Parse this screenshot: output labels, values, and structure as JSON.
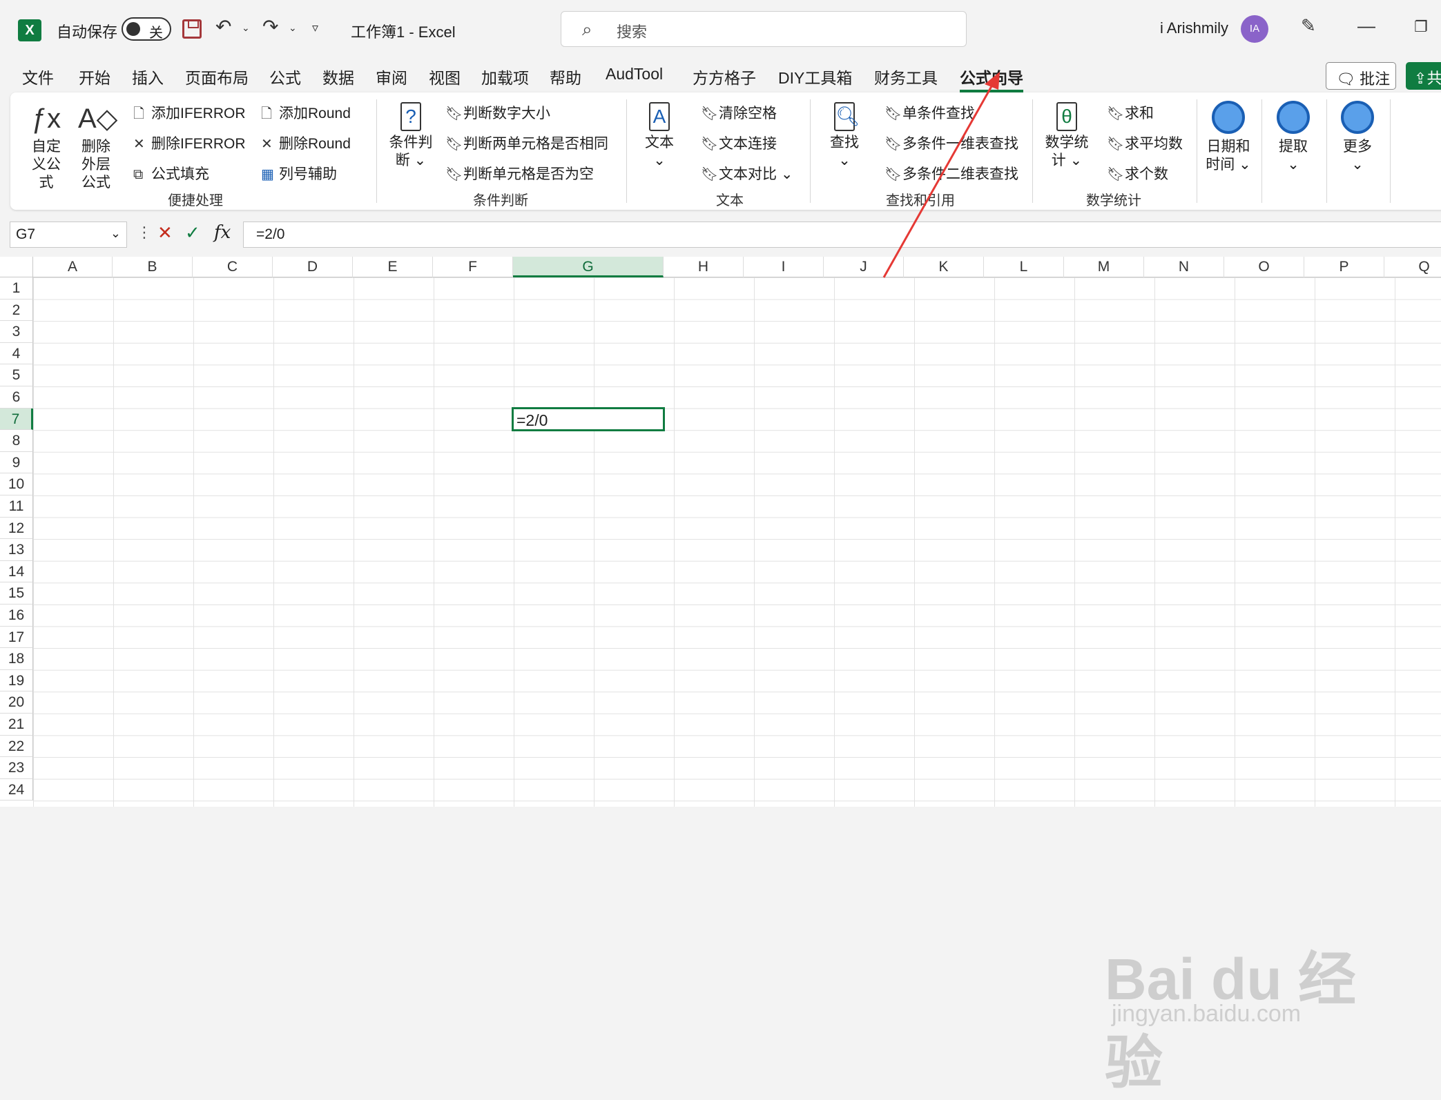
{
  "titlebar": {
    "autosave_label": "自动保存",
    "autosave_state": "关",
    "doc_title": "工作簿1  -  Excel",
    "search_placeholder": "搜索",
    "user_name": "i Arishmily",
    "avatar_initials": "IA"
  },
  "menu": {
    "tabs": [
      "文件",
      "开始",
      "插入",
      "页面布局",
      "公式",
      "数据",
      "审阅",
      "视图",
      "加载项",
      "帮助",
      "AudTool",
      "方方格子",
      "DIY工具箱",
      "财务工具",
      "公式向导"
    ],
    "active_tab": "公式向导",
    "comment_label": "批注",
    "share_label": "共"
  },
  "ribbon": {
    "quick": {
      "custom_formula": "自定义公式",
      "remove_outer": "删除外层公式",
      "add_iferror": "添加IFERROR",
      "del_iferror": "删除IFERROR",
      "formula_fill": "公式填充",
      "add_round": "添加Round",
      "del_round": "删除Round",
      "col_helper": "列号辅助",
      "label": "便捷处理"
    },
    "cond": {
      "big": "条件判断",
      "i1": "判断数字大小",
      "i2": "判断两单元格是否相同",
      "i3": "判断单元格是否为空",
      "label": "条件判断"
    },
    "text": {
      "big": "文本",
      "i1": "清除空格",
      "i2": "文本连接",
      "i3": "文本对比",
      "label": "文本"
    },
    "lookup": {
      "big": "查找",
      "i1": "单条件查找",
      "i2": "多条件一维表查找",
      "i3": "多条件二维表查找",
      "label": "查找和引用"
    },
    "math": {
      "big": "数学统计",
      "i1": "求和",
      "i2": "求平均数",
      "i3": "求个数",
      "label": "数学统计"
    },
    "datetime": "日期和时间",
    "extract": "提取",
    "more": "更多"
  },
  "formula_bar": {
    "name_box": "G7",
    "formula": "=2/0"
  },
  "grid": {
    "columns": [
      "A",
      "B",
      "C",
      "D",
      "E",
      "F",
      "G",
      "H",
      "I",
      "J",
      "K",
      "L",
      "M",
      "N",
      "O",
      "P",
      "Q"
    ],
    "rows": [
      "1",
      "2",
      "3",
      "4",
      "5",
      "6",
      "7",
      "8",
      "9",
      "10",
      "11",
      "12",
      "13",
      "14",
      "15",
      "16",
      "17",
      "18",
      "19",
      "20",
      "21",
      "22",
      "23",
      "24"
    ],
    "selected_column": "G",
    "selected_row": "7",
    "active_cell_value": "=2/0"
  },
  "watermark": {
    "brand": "Bai du 经验",
    "url": "jingyan.baidu.com"
  },
  "colors": {
    "accent": "#107c41",
    "annotation_arrow": "#e53935"
  }
}
